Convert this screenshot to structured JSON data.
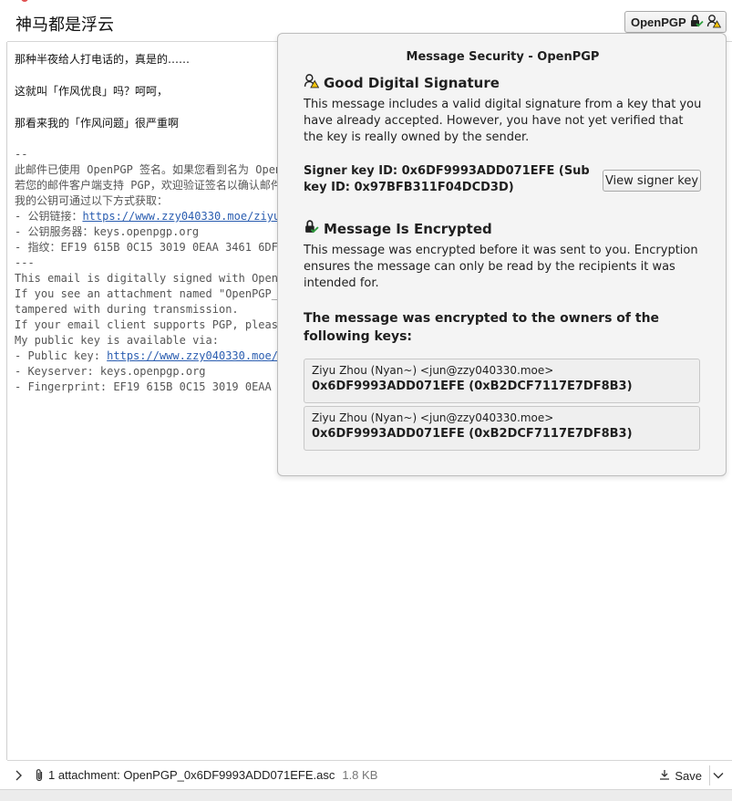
{
  "header": {
    "subject": "神马都是浮云",
    "openpgp_label": "OpenPGP"
  },
  "body": {
    "lines": [
      "那种半夜给人打电话的，真是的……",
      "这就叫「作风优良」吗？呵呵，",
      "那看来我的「作风问题」很严重啊"
    ],
    "signature": {
      "sep1": "--",
      "cn1": "此邮件已使用 OpenPGP 签名。如果您看到名为 Open",
      "cn2": "若您的邮件客户端支持 PGP，欢迎验证签名以确认邮件",
      "cn3": "我的公钥可通过以下方式获取：",
      "cn_pubkey_prefix": "- 公钥链接：",
      "cn_pubkey_link": "https://www.zzy040330.moe/ziyu",
      "cn_keyserver": "- 公钥服务器：keys.openpgp.org",
      "cn_fingerprint": "- 指纹：EF19 615B 0C15 3019 0EAA 3461 6DF",
      "sep2": "---",
      "en1": "This email is digitally signed with Open",
      "en2": "If you see an attachment named \"OpenPGP_",
      "en3": "tampered with during transmission.",
      "en4": "If your email client supports PGP, pleas",
      "en5": "My public key is available via:",
      "en_pubkey_prefix": "- Public key: ",
      "en_pubkey_link": "https://www.zzy040330.moe/",
      "en_keyserver": "- Keyserver: keys.openpgp.org",
      "en_fingerprint": "- Fingerprint: EF19 615B 0C15 3019 0EAA"
    }
  },
  "popup": {
    "title": "Message Security - OpenPGP",
    "signature_heading": "Good Digital Signature",
    "signature_text": "This message includes a valid digital signature from a key that you have already accepted. However, you have not yet verified that the key is really owned by the sender.",
    "signer_key": "Signer key ID: 0x6DF9993ADD071EFE (Sub key ID: 0x97BFB311F04DCD3D)",
    "view_signer_label": "View signer key",
    "encrypted_heading": "Message Is Encrypted",
    "encrypted_text": "This message was encrypted before it was sent to you. Encryption ensures the message can only be read by the recipients it was intended for.",
    "owners_heading": "The message was encrypted to the owners of the following keys:",
    "keys": [
      {
        "name": "Ziyu Zhou (Nyan~) <jun@zzy040330.moe>",
        "id": "0x6DF9993ADD071EFE (0xB2DCF7117E7DF8B3)"
      },
      {
        "name": "Ziyu Zhou (Nyan~) <jun@zzy040330.moe>",
        "id": "0x6DF9993ADD071EFE (0xB2DCF7117E7DF8B3)"
      }
    ]
  },
  "attachments": {
    "summary": "1 attachment: OpenPGP_0x6DF9993ADD071EFE.asc",
    "size": "1.8 KB",
    "save_label": "Save"
  },
  "icons": {
    "lock": "lock-icon",
    "check": "check-icon",
    "signature": "signature-icon",
    "paperclip": "paperclip-icon",
    "download": "download-icon",
    "chevron_right": "chevron-right-icon",
    "chevron_down": "chevron-down-icon"
  },
  "colors": {
    "accent_link": "#2a5db0",
    "check_green": "#2e9e3e",
    "warning_yellow": "#f3c20c"
  }
}
